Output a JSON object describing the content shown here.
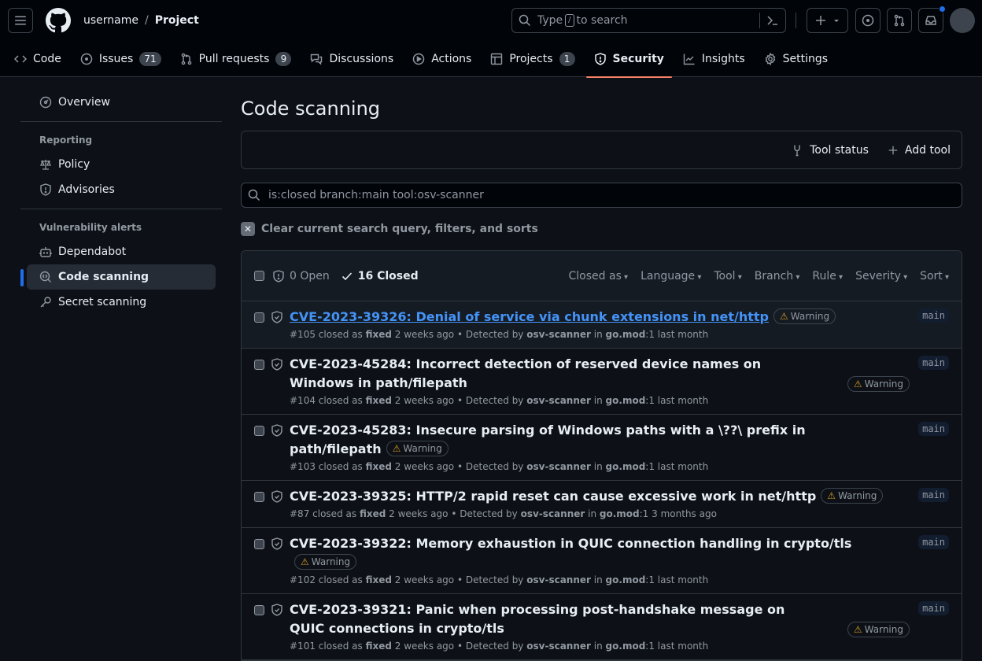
{
  "header": {
    "owner": "username",
    "separator": "/",
    "repo": "Project",
    "search": {
      "prefix": "Type",
      "key": "/",
      "suffix": "to search"
    }
  },
  "tabs": [
    {
      "label": "Code",
      "icon": "code-icon"
    },
    {
      "label": "Issues",
      "count": "71",
      "icon": "issue-icon"
    },
    {
      "label": "Pull requests",
      "count": "9",
      "icon": "pull-request-icon"
    },
    {
      "label": "Discussions",
      "icon": "discussion-icon"
    },
    {
      "label": "Actions",
      "icon": "play-icon"
    },
    {
      "label": "Projects",
      "count": "1",
      "icon": "table-icon"
    },
    {
      "label": "Security",
      "icon": "shield-icon",
      "active": true
    },
    {
      "label": "Insights",
      "icon": "graph-icon"
    },
    {
      "label": "Settings",
      "icon": "gear-icon"
    }
  ],
  "sidebar": {
    "overview": "Overview",
    "reporting_heading": "Reporting",
    "policy": "Policy",
    "advisories": "Advisories",
    "alerts_heading": "Vulnerability alerts",
    "dependabot": "Dependabot",
    "code_scanning": "Code scanning",
    "secret_scanning": "Secret scanning"
  },
  "main": {
    "title": "Code scanning",
    "tool_status": "Tool status",
    "add_tool": "Add tool",
    "query": "is:closed branch:main tool:osv-scanner",
    "clear": "Clear current search query, filters, and sorts",
    "open_count": "0 Open",
    "closed_count": "16 Closed",
    "filters": [
      "Closed as",
      "Language",
      "Tool",
      "Branch",
      "Rule",
      "Severity",
      "Sort"
    ]
  },
  "alerts": [
    {
      "title": "CVE-2023-39326: Denial of service via chunk extensions in net/http",
      "number": "#105",
      "closed_as": "fixed",
      "closed_when": "2 weeks ago",
      "tool": "osv-scanner",
      "file": "go.mod",
      "line": ":1",
      "detected_when": "last month",
      "severity": "Warning",
      "branch": "main"
    },
    {
      "title": "CVE-2023-45284: Incorrect detection of reserved device names on Windows in path/filepath",
      "number": "#104",
      "closed_as": "fixed",
      "closed_when": "2 weeks ago",
      "tool": "osv-scanner",
      "file": "go.mod",
      "line": ":1",
      "detected_when": "last month",
      "severity": "Warning",
      "branch": "main"
    },
    {
      "title": "CVE-2023-45283: Insecure parsing of Windows paths with a \\??\\ prefix in path/filepath",
      "number": "#103",
      "closed_as": "fixed",
      "closed_when": "2 weeks ago",
      "tool": "osv-scanner",
      "file": "go.mod",
      "line": ":1",
      "detected_when": "last month",
      "severity": "Warning",
      "branch": "main"
    },
    {
      "title": "CVE-2023-39325: HTTP/2 rapid reset can cause excessive work in net/http",
      "number": "#87",
      "closed_as": "fixed",
      "closed_when": "2 weeks ago",
      "tool": "osv-scanner",
      "file": "go.mod",
      "line": ":1",
      "detected_when": "3 months ago",
      "severity": "Warning",
      "branch": "main"
    },
    {
      "title": "CVE-2023-39322: Memory exhaustion in QUIC connection handling in crypto/tls",
      "number": "#102",
      "closed_as": "fixed",
      "closed_when": "2 weeks ago",
      "tool": "osv-scanner",
      "file": "go.mod",
      "line": ":1",
      "detected_when": "last month",
      "severity": "Warning",
      "branch": "main"
    },
    {
      "title": "CVE-2023-39321: Panic when processing post-handshake message on QUIC connections in crypto/tls",
      "number": "#101",
      "closed_as": "fixed",
      "closed_when": "2 weeks ago",
      "tool": "osv-scanner",
      "file": "go.mod",
      "line": ":1",
      "detected_when": "last month",
      "severity": "Warning",
      "branch": "main"
    }
  ],
  "labels": {
    "closed_as": "closed as",
    "detected_by": "• Detected by",
    "in": "in"
  }
}
